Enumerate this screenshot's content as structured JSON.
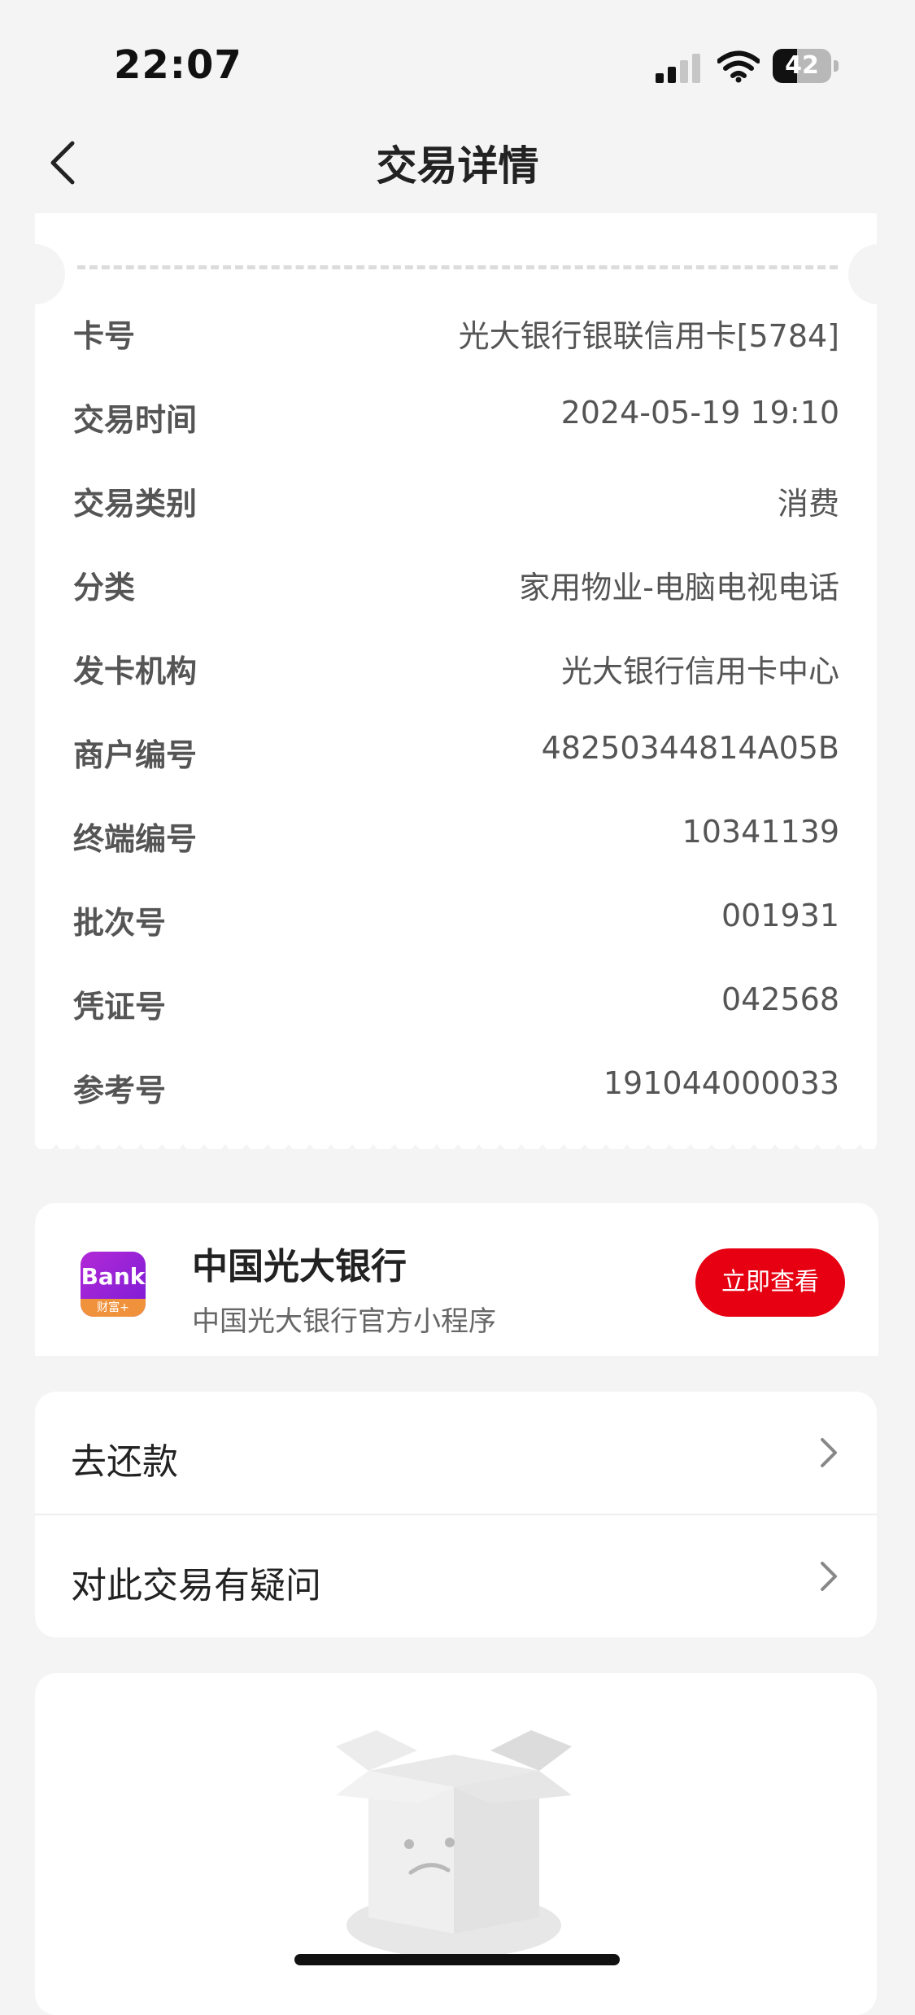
{
  "status_bar": {
    "time": "22:07",
    "battery_level": "42"
  },
  "nav": {
    "title": "交易详情"
  },
  "details": [
    {
      "label": "卡号",
      "value": "光大银行银联信用卡[5784]"
    },
    {
      "label": "交易时间",
      "value": "2024-05-19 19:10"
    },
    {
      "label": "交易类别",
      "value": "消费"
    },
    {
      "label": "分类",
      "value": "家用物业-电脑电视电话"
    },
    {
      "label": "发卡机构",
      "value": "光大银行信用卡中心"
    },
    {
      "label": "商户编号",
      "value": "48250344814A05B"
    },
    {
      "label": "终端编号",
      "value": "10341139"
    },
    {
      "label": "批次号",
      "value": "001931"
    },
    {
      "label": "凭证号",
      "value": "042568"
    },
    {
      "label": "参考号",
      "value": "191044000033"
    }
  ],
  "mini_program": {
    "icon_text": "Bank",
    "icon_badge": "财富+",
    "name": "中国光大银行",
    "subtitle": "中国光大银行官方小程序",
    "button": "立即查看"
  },
  "actions": [
    {
      "label": "去还款"
    },
    {
      "label": "对此交易有疑问"
    }
  ],
  "icons": {
    "back": "chevron-left-icon",
    "row_arrow": "chevron-right-icon",
    "empty": "empty-box-icon"
  },
  "colors": {
    "accent": "#e60012",
    "background": "#f4f4f4"
  }
}
